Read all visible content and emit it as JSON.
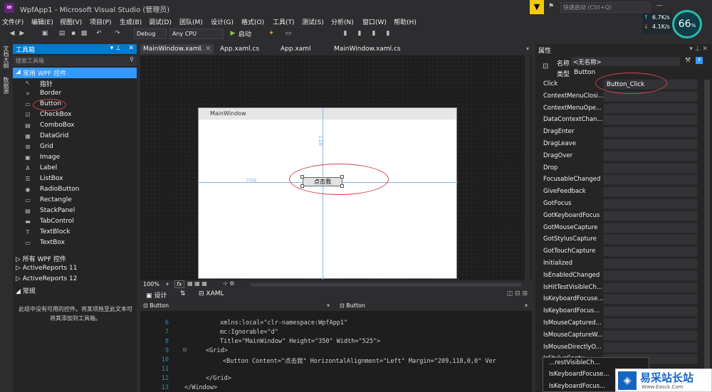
{
  "window": {
    "title": "WpfApp1 - Microsoft Visual Studio (管理员)"
  },
  "menu": [
    "文件(F)",
    "编辑(E)",
    "视图(V)",
    "项目(P)",
    "生成(B)",
    "调试(D)",
    "团队(M)",
    "设计(G)",
    "格式(O)",
    "工具(T)",
    "测试(S)",
    "分析(N)",
    "窗口(W)",
    "帮助(H)"
  ],
  "toolbar": {
    "config": "Debug",
    "platform": "Any CPU",
    "start_label": "启动"
  },
  "quick_launch": {
    "placeholder": "快速启动 (Ctrl+Q)"
  },
  "netmon": {
    "up": "6.7K/s",
    "down": "4.1K/s",
    "percent": "66"
  },
  "side_tabs": [
    "文档大纲",
    "数据源"
  ],
  "toolbox": {
    "title": "工具箱",
    "search_placeholder": "搜索工具箱",
    "group": "常用 WPF 控件",
    "items": [
      "指针",
      "Border",
      "Button",
      "CheckBox",
      "ComboBox",
      "DataGrid",
      "Grid",
      "Image",
      "Label",
      "ListBox",
      "RadioButton",
      "Rectangle",
      "StackPanel",
      "TabControl",
      "TextBlock",
      "TextBox"
    ],
    "other_groups": [
      "所有 WPF 控件",
      "ActiveReports 11",
      "ActiveReports 12",
      "常规"
    ],
    "empty_message": "此组中没有可用的控件。将某项拖至此文本可将其添加到工具箱。"
  },
  "doc_tabs": [
    "MainWindow.xaml",
    "App.xaml.cs",
    "App.xaml",
    "MainWindow.xaml.cs"
  ],
  "designer": {
    "window_title": "MainWindow",
    "button_text": "点击我",
    "margin_left": "209",
    "margin_top": "118",
    "zoom": "100%",
    "fx_label": "fx"
  },
  "view_tabs": {
    "design": "设计",
    "swap": "⇅",
    "xaml": "XAML"
  },
  "scope": {
    "left": "Button",
    "right": "Button"
  },
  "code_lines": [
    {
      "n": "6",
      "t": "xmlns:local=\"clr-namespace:WpfApp1\""
    },
    {
      "n": "7",
      "t": "mc:Ignorable=\"d\""
    },
    {
      "n": "8",
      "t": "Title=\"MainWindow\" Height=\"350\" Width=\"525\">"
    },
    {
      "n": "9",
      "t": "<Grid>"
    },
    {
      "n": "10",
      "t": "<Button Content=\"点击我\" HorizontalAlignment=\"Left\" Margin=\"209,118,0,0\" Ver"
    },
    {
      "n": "11",
      "t": ""
    },
    {
      "n": "12",
      "t": "</Grid>"
    },
    {
      "n": "13",
      "t": "</Window>"
    }
  ],
  "properties": {
    "title": "属性",
    "name_label": "名称",
    "name_value": "<无名称>",
    "type_label": "类型",
    "type_value": "Button",
    "events": [
      {
        "name": "Click",
        "value": "Button_Click"
      },
      {
        "name": "ContextMenuClosi...",
        "value": ""
      },
      {
        "name": "ContextMenuOpe...",
        "value": ""
      },
      {
        "name": "DataContextChan...",
        "value": ""
      },
      {
        "name": "DragEnter",
        "value": ""
      },
      {
        "name": "DragLeave",
        "value": ""
      },
      {
        "name": "DragOver",
        "value": ""
      },
      {
        "name": "Drop",
        "value": ""
      },
      {
        "name": "FocusableChanged",
        "value": ""
      },
      {
        "name": "GiveFeedback",
        "value": ""
      },
      {
        "name": "GotFocus",
        "value": ""
      },
      {
        "name": "GotKeyboardFocus",
        "value": ""
      },
      {
        "name": "GotMouseCapture",
        "value": ""
      },
      {
        "name": "GotStylusCapture",
        "value": ""
      },
      {
        "name": "GotTouchCapture",
        "value": ""
      },
      {
        "name": "Initialized",
        "value": ""
      },
      {
        "name": "IsEnabledChanged",
        "value": ""
      },
      {
        "name": "IsHitTestVisibleCh...",
        "value": ""
      },
      {
        "name": "IsKeyboardFocuse...",
        "value": ""
      },
      {
        "name": "IsKeyboardFocus...",
        "value": ""
      },
      {
        "name": "IsMouseCaptured...",
        "value": ""
      },
      {
        "name": "IsMouseCaptureW...",
        "value": ""
      },
      {
        "name": "IsMouseDirectlyO...",
        "value": ""
      },
      {
        "name": "IsStylusCaptu...",
        "value": ""
      }
    ],
    "tooltip_lines": [
      "...restVisibleCh...",
      "IsKeyboardFocuse...",
      "IsKeyboardFocus..."
    ]
  },
  "watermark": {
    "text": "易采站长站",
    "sub": "Www.Easck.Com"
  }
}
